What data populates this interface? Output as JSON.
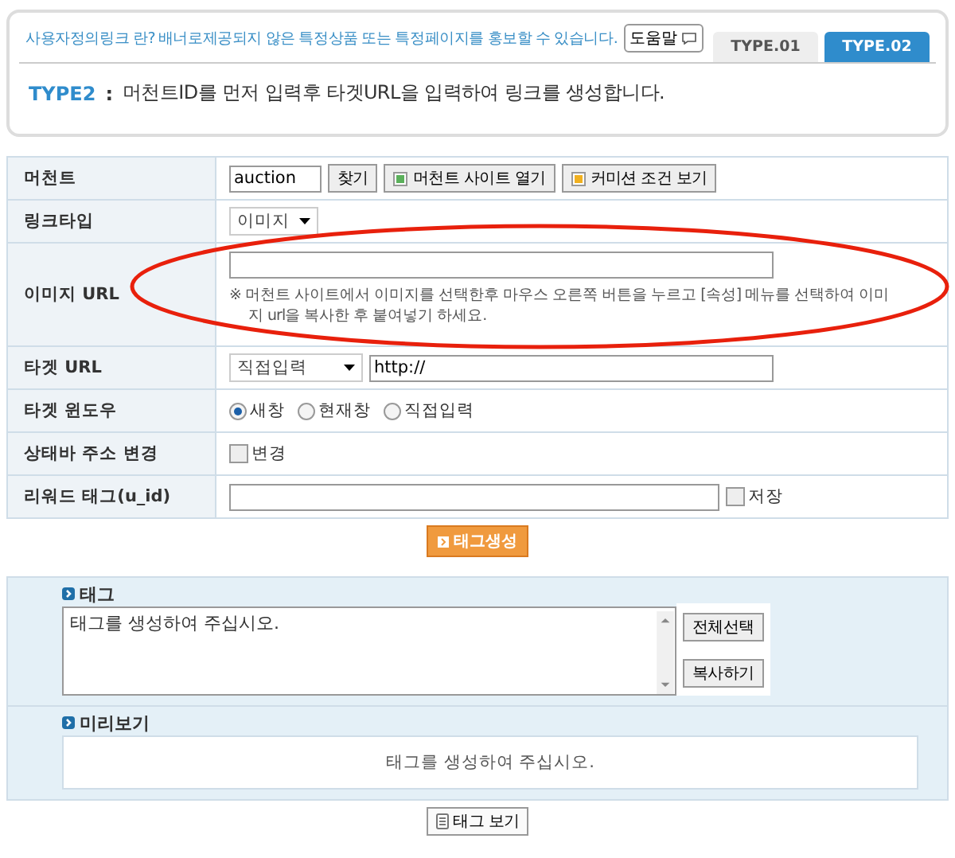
{
  "header": {
    "notice": "사용자정의링크 란? 배너로제공되지 않은 특정상품 또는 특정페이지를 홍보할 수 있습니다.",
    "help_button": "도움말",
    "tabs": [
      {
        "label": "TYPE.01",
        "selected": false
      },
      {
        "label": "TYPE.02",
        "selected": true
      }
    ],
    "type_label": "TYPE2",
    "separator": ":",
    "description": "머천트ID를 먼저 입력후 타겟URL을 입력하여 링크를 생성합니다."
  },
  "form": [
    {
      "kind": "merchant",
      "label": "머천트",
      "value": "auction",
      "buttons": [
        "찾기",
        "머천트 사이트 열기",
        "커미션 조건 보기"
      ]
    },
    {
      "kind": "select",
      "label": "링크타입",
      "value": "이미지"
    },
    {
      "kind": "url_note",
      "label": "이미지 URL",
      "note": "※ 머천트 사이트에서 이미지를 선택한후 마우스 오른쪽 버튼을 누르고 [속성] 메뉴를 선택하여 이미지 url을 복사한 후 붙여넣기 하세요."
    },
    {
      "kind": "select_input",
      "label": "타겟 URL",
      "select": "직접입력",
      "value": "http://"
    },
    {
      "kind": "radio",
      "label": "타겟 윈도우",
      "options": [
        {
          "label": "새창",
          "selected": true
        },
        {
          "label": "현재창",
          "selected": false
        },
        {
          "label": "직접입력",
          "selected": false
        }
      ]
    },
    {
      "kind": "checkbox",
      "label": "상태바 주소 변경",
      "option": {
        "label": "변경",
        "checked": false
      }
    },
    {
      "kind": "input_checkbox",
      "label": "리워드 태그(u_id)",
      "option": {
        "label": "저장",
        "checked": false
      }
    }
  ],
  "annotation_ellipse": true,
  "generate_button": "태그생성",
  "tag_section": {
    "title": "태그",
    "text": "태그를 생성하여 주십시오.",
    "buttons": [
      "전체선택",
      "복사하기"
    ]
  },
  "preview_section": {
    "title": "미리보기",
    "text": "태그를 생성하여 주십시오."
  },
  "view_button": "태그 보기"
}
